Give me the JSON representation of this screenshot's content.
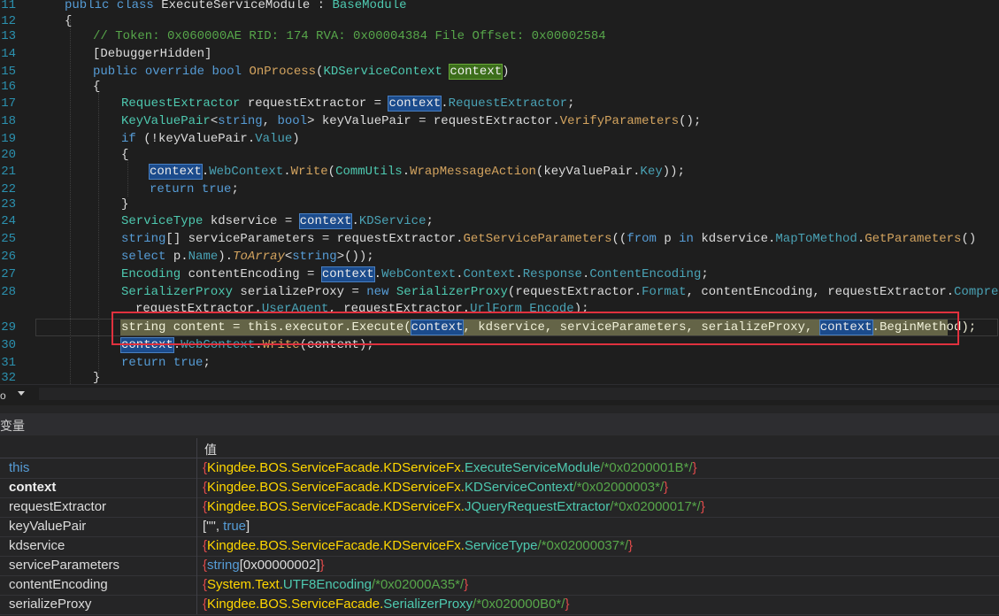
{
  "editor": {
    "line_numbers": [
      "11",
      "12",
      "13",
      "14",
      "15",
      "16",
      "17",
      "18",
      "19",
      "20",
      "21",
      "22",
      "23",
      "24",
      "25",
      "26",
      "27",
      "28",
      "29",
      "30",
      "31",
      "32"
    ],
    "lines": {
      "l11": {
        "kw1": "public",
        "kw2": "class",
        "name": "ExecuteServiceModule",
        "sep": " : ",
        "base": "BaseModule"
      },
      "l12": {
        "text": "{"
      },
      "l13": {
        "text": "// Token: 0x060000AE RID: 174 RVA: 0x00004384 File Offset: 0x00002584"
      },
      "l14": {
        "text": "[DebuggerHidden]"
      },
      "l15": {
        "kw1": "public",
        "kw2": "override",
        "kw3": "bool",
        "method": "OnProcess",
        "p1": "(",
        "type": "KDServiceContext",
        "param": "context",
        "p2": ")"
      },
      "l16": {
        "text": "{"
      },
      "l17": {
        "type": "RequestExtractor",
        "t1": " requestExtractor = ",
        "ctx": "context",
        "t2": ".",
        "member": "RequestExtractor",
        "t3": ";"
      },
      "l18": {
        "type": "KeyValuePair",
        "t1": "<",
        "kw1": "string",
        "t2": ", ",
        "kw2": "bool",
        "t3": "> keyValuePair = requestExtractor.",
        "method": "VerifyParameters",
        "t4": "();"
      },
      "l19": {
        "kw": "if",
        "t1": " (!keyValuePair.",
        "member": "Value",
        "t2": ")"
      },
      "l20": {
        "text": "{"
      },
      "l21": {
        "ctx": "context",
        "t1": ".",
        "m1": "WebContext",
        "t2": ".",
        "m2": "Write",
        "t3": "(",
        "type": "CommUtils",
        "t4": ".",
        "m3": "WrapMessageAction",
        "t5": "(keyValuePair.",
        "m4": "Key",
        "t6": "));"
      },
      "l22": {
        "kw1": "return",
        "kw2": "true",
        "t1": ";"
      },
      "l23": {
        "text": "}"
      },
      "l24": {
        "type": "ServiceType",
        "t1": " kdservice = ",
        "ctx": "context",
        "t2": ".",
        "member": "KDService",
        "t3": ";"
      },
      "l25": {
        "kw1": "string",
        "t1": "[] serviceParameters = requestExtractor.",
        "method": "GetServiceParameters",
        "t2": "((",
        "kw2": "from",
        "t3": " p ",
        "kw3": "in",
        "t4": " kdservice.",
        "m2": "MapToMethod",
        "t5": ".",
        "m3": "GetParameters",
        "t6": "()"
      },
      "l26": {
        "kw1": "select",
        "t1": " p.",
        "m1": "Name",
        "t2": ").",
        "m2": "ToArray",
        "t3": "<",
        "kw2": "string",
        "t4": ">());"
      },
      "l27": {
        "type": "Encoding",
        "t1": " contentEncoding = ",
        "ctx": "context",
        "t2": ".",
        "m1": "WebContext",
        "t3": ".",
        "m2": "Context",
        "t4": ".",
        "m3": "Response",
        "t5": ".",
        "m4": "ContentEncoding",
        "t6": ";"
      },
      "l28": {
        "type": "SerializerProxy",
        "t1": " serializeProxy = ",
        "kw": "new",
        "t2": " ",
        "type2": "SerializerProxy",
        "t3": "(requestExtractor.",
        "m1": "Format",
        "t4": ", contentEncoding, requestExtractor.",
        "m2": "Compressed",
        "t5": ","
      },
      "l28b": {
        "t1": "requestExtractor.",
        "m1": "UserAgent",
        "t2": ", requestExtractor.",
        "m2": "UrlForm_Encode",
        "t3": ");"
      },
      "l29": {
        "t1": "string content = this.executor.Execute(",
        "ctx": "context",
        "t2": ", kdservice, serviceParameters, serializeProxy, ",
        "ctx2": "context",
        "t3": ".BeginMethod);"
      },
      "l30": {
        "ctx": "context",
        "t1": ".",
        "m1": "WebContext",
        "t2": ".",
        "m2": "Write",
        "t3": "(content);"
      },
      "l31": {
        "kw1": "return",
        "kw2": "true",
        "t1": ";"
      },
      "l32": {
        "text": "}"
      }
    }
  },
  "statusbar": {
    "zoom_label": "o"
  },
  "locals": {
    "title": "变量",
    "value_header": "值",
    "rows": [
      {
        "name": "this",
        "ns": "Kingdee.BOS.ServiceFacade.KDServiceFx.",
        "cls": "ExecuteServiceModule",
        "tok": "/*0x0200001B*/"
      },
      {
        "name": "context",
        "ns": "Kingdee.BOS.ServiceFacade.KDServiceFx.",
        "cls": "KDServiceContext",
        "tok": "/*0x02000003*/"
      },
      {
        "name": "requestExtractor",
        "ns": "Kingdee.BOS.ServiceFacade.KDServiceFx.",
        "cls": "JQueryRequestExtractor",
        "tok": "/*0x02000017*/"
      },
      {
        "name": "keyValuePair",
        "v1": "[\"\", ",
        "v2": "true",
        "v3": "]"
      },
      {
        "name": "kdservice",
        "ns": "Kingdee.BOS.ServiceFacade.KDServiceFx.",
        "cls": "ServiceType",
        "tok": "/*0x02000037*/"
      },
      {
        "name": "serviceParameters",
        "kw": "string",
        "rest": "[0x00000002]"
      },
      {
        "name": "contentEncoding",
        "ns": "System.Text.",
        "cls": "UTF8Encoding",
        "tok": "/*0x02000A35*/"
      },
      {
        "name": "serializeProxy",
        "ns": "Kingdee.BOS.ServiceFacade.",
        "cls": "SerializerProxy",
        "tok": "/*0x020000B0*/"
      }
    ],
    "open_brace": "{",
    "close_brace": "}"
  },
  "colors": {
    "highlight_box": "#e0313e",
    "keyword": "#569cd6",
    "type": "#4ec9b0",
    "method": "#d4a45f",
    "comment": "#57a64a"
  }
}
